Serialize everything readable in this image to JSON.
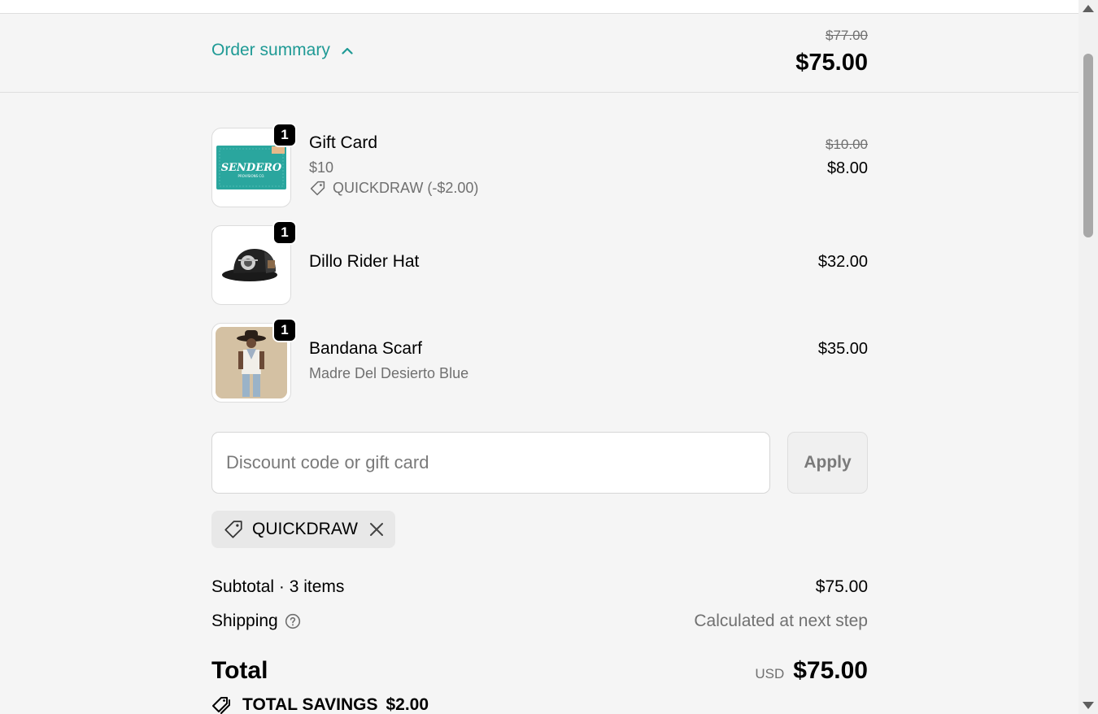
{
  "header": {
    "toggle_label": "Order summary",
    "compare_total": "$77.00",
    "total": "$75.00"
  },
  "items": [
    {
      "name": "Gift Card",
      "variant": "$10",
      "discount": "QUICKDRAW (-$2.00)",
      "original_price": "$10.00",
      "price": "$8.00",
      "quantity": "1",
      "image_text": "SENDERO",
      "image_subtext": "PROVISIONS CO."
    },
    {
      "name": "Dillo Rider Hat",
      "price": "$32.00",
      "quantity": "1"
    },
    {
      "name": "Bandana Scarf",
      "variant": "Madre Del Desierto Blue",
      "price": "$35.00",
      "quantity": "1"
    }
  ],
  "discount": {
    "placeholder": "Discount code or gift card",
    "apply_label": "Apply",
    "applied_code": "QUICKDRAW"
  },
  "totals": {
    "subtotal_label": "Subtotal · 3 items",
    "subtotal_value": "$75.00",
    "shipping_label": "Shipping",
    "shipping_value": "Calculated at next step",
    "total_label": "Total",
    "currency": "USD",
    "total_value": "$75.00",
    "savings_label": "TOTAL SAVINGS",
    "savings_value": "$2.00"
  },
  "colors": {
    "accent": "#1f9a95",
    "gift_card_teal": "#2aa69e"
  }
}
